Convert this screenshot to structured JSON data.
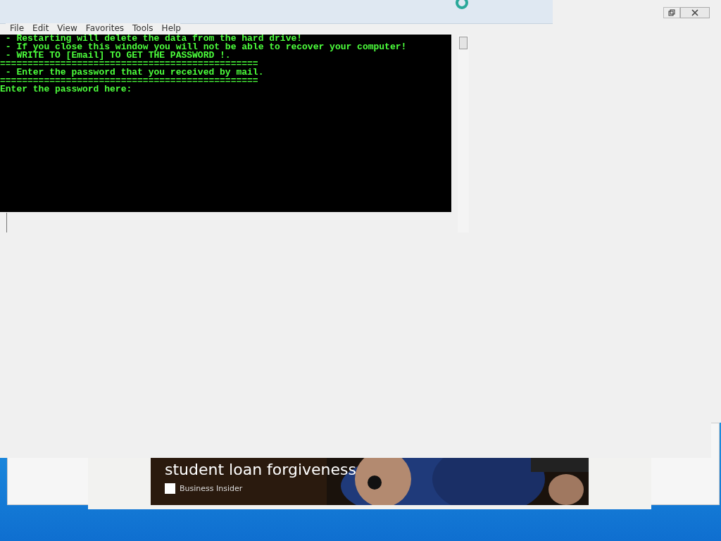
{
  "menu": [
    {
      "label": "File"
    },
    {
      "label": "Edit"
    },
    {
      "label": "View"
    },
    {
      "label": "Favorites"
    },
    {
      "label": "Tools"
    },
    {
      "label": "Help"
    }
  ],
  "console": {
    "lines": [
      " - Restarting will delete the data from the hard drive!",
      " - If you close this window you will not be able to recover your computer!",
      " - WRITE TO [Email] TO GET THE PASSWORD !.",
      "===============================================",
      " - Enter the password that you received by mail.",
      "==============================================="
    ],
    "prompt": "Enter the password here:"
  },
  "news": {
    "headline": "student loan forgiveness",
    "source": "Business Insider"
  }
}
